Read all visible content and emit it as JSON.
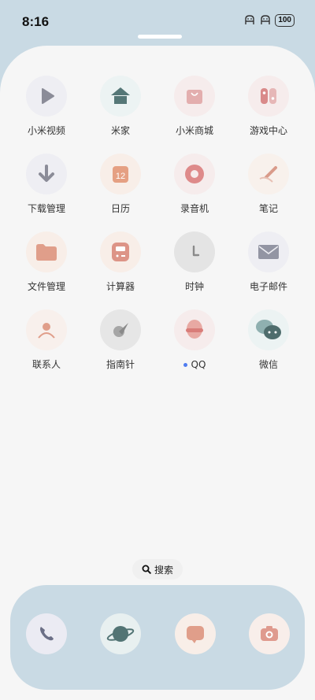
{
  "status_bar": {
    "time": "8:16",
    "battery": "100"
  },
  "apps": [
    {
      "label": "小米视频",
      "icon": "video-play-icon",
      "bg": "#eeeef3"
    },
    {
      "label": "米家",
      "icon": "home-icon",
      "bg": "#ecf3f3"
    },
    {
      "label": "小米商城",
      "icon": "shopping-bag-icon",
      "bg": "#f6ecec"
    },
    {
      "label": "游戏中心",
      "icon": "game-controller-icon",
      "bg": "#f6ecec"
    },
    {
      "label": "下载管理",
      "icon": "download-arrow-icon",
      "bg": "#eeeef3"
    },
    {
      "label": "日历",
      "icon": "calendar-icon",
      "bg": "#f8eee8"
    },
    {
      "label": "录音机",
      "icon": "record-icon",
      "bg": "#f6ecec"
    },
    {
      "label": "笔记",
      "icon": "pen-icon",
      "bg": "#f8f1ec"
    },
    {
      "label": "文件管理",
      "icon": "folder-icon",
      "bg": "#f8eee8"
    },
    {
      "label": "计算器",
      "icon": "calculator-icon",
      "bg": "#f8eee8"
    },
    {
      "label": "时钟",
      "icon": "clock-icon",
      "bg": "#ececec"
    },
    {
      "label": "电子邮件",
      "icon": "mail-icon",
      "bg": "#eeeef3"
    },
    {
      "label": "联系人",
      "icon": "contact-person-icon",
      "bg": "#f8f0ec"
    },
    {
      "label": "指南针",
      "icon": "compass-icon",
      "bg": "#ececec"
    },
    {
      "label": "QQ",
      "icon": "qq-penguin-icon",
      "bg": "#f6ecec",
      "dot": true
    },
    {
      "label": "微信",
      "icon": "wechat-bubbles-icon",
      "bg": "#ecf3f3"
    }
  ],
  "search": {
    "label": "搜索"
  },
  "dock": [
    {
      "icon": "phone-icon"
    },
    {
      "icon": "browser-planet-icon"
    },
    {
      "icon": "messages-icon"
    },
    {
      "icon": "camera-icon"
    }
  ]
}
